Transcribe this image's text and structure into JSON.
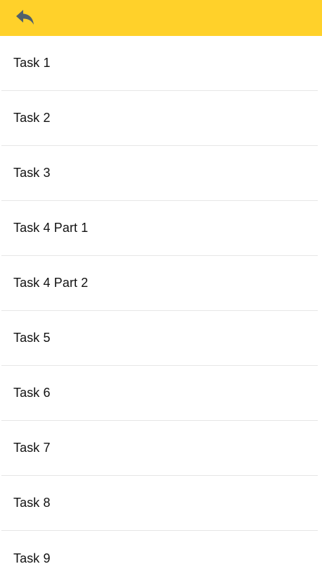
{
  "header": {
    "back_icon": "reply-arrow-icon",
    "background_color": "#ffd12a",
    "icon_color": "#51606b"
  },
  "tasks": [
    {
      "label": "Task 1"
    },
    {
      "label": "Task 2"
    },
    {
      "label": "Task 3"
    },
    {
      "label": "Task 4 Part 1"
    },
    {
      "label": "Task 4 Part 2"
    },
    {
      "label": "Task 5"
    },
    {
      "label": "Task 6"
    },
    {
      "label": "Task 7"
    },
    {
      "label": "Task 8"
    },
    {
      "label": "Task 9"
    }
  ]
}
